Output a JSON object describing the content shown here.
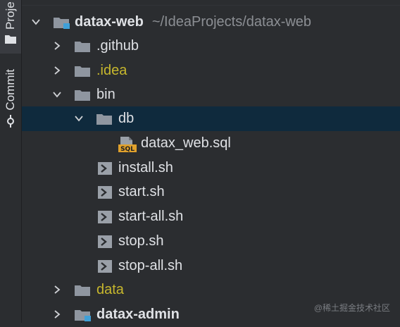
{
  "side_strip": {
    "project_tab": "Proje",
    "commit_tab": "Commit"
  },
  "tree": {
    "rows": [
      {
        "label": "datax-web",
        "path": "~/IdeaProjects/datax-web",
        "expanded": true,
        "type": "module-root"
      },
      {
        "label": ".github",
        "expanded": false,
        "type": "folder"
      },
      {
        "label": ".idea",
        "expanded": false,
        "type": "folder-excluded"
      },
      {
        "label": "bin",
        "expanded": true,
        "type": "folder"
      },
      {
        "label": "db",
        "expanded": true,
        "type": "folder",
        "selected": true
      },
      {
        "label": "datax_web.sql",
        "type": "sql-file",
        "icon_text": "SQL"
      },
      {
        "label": "install.sh",
        "type": "shell-file"
      },
      {
        "label": "start.sh",
        "type": "shell-file"
      },
      {
        "label": "start-all.sh",
        "type": "shell-file"
      },
      {
        "label": "stop.sh",
        "type": "shell-file"
      },
      {
        "label": "stop-all.sh",
        "type": "shell-file"
      },
      {
        "label": "data",
        "expanded": false,
        "type": "folder-excluded"
      },
      {
        "label": "datax-admin",
        "expanded": false,
        "type": "module"
      }
    ]
  },
  "watermark": "@稀土掘金技术社区",
  "colors": {
    "background": "#2b2d30",
    "selection": "#0f2a3d",
    "text": "#dfe1e5",
    "path_text": "#8c8f94",
    "excluded_text": "#c7b72d",
    "folder": "#8f96a0",
    "module_badge": "#3fa0d8",
    "sql_badge": "#e0a12c"
  }
}
